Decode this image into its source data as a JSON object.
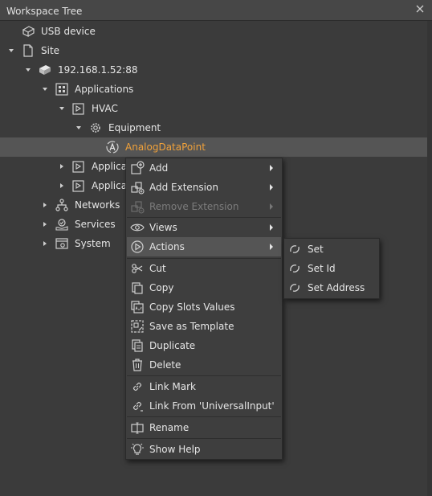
{
  "panel": {
    "title": "Workspace Tree"
  },
  "tree": {
    "usb_device": "USB device",
    "site": "Site",
    "ip": "192.168.1.52:88",
    "applications": "Applications",
    "hvac": "HVAC",
    "equipment": "Equipment",
    "analog_data_point": "AnalogDataPoint",
    "application_partial_1": "Applicat",
    "application_partial_2": "Applicat",
    "networks": "Networks",
    "services": "Services",
    "system": "System"
  },
  "context_menu": {
    "add": "Add",
    "add_extension": "Add Extension",
    "remove_extension": "Remove Extension",
    "views": "Views",
    "actions": "Actions",
    "cut": "Cut",
    "copy": "Copy",
    "copy_slots_values": "Copy Slots Values",
    "save_as_template": "Save as Template",
    "duplicate": "Duplicate",
    "delete": "Delete",
    "link_mark": "Link Mark",
    "link_from": "Link From 'UniversalInput'",
    "rename": "Rename",
    "show_help": "Show Help"
  },
  "actions_submenu": {
    "set": "Set",
    "set_id": "Set Id",
    "set_address": "Set Address"
  },
  "colors": {
    "background": "#3b3b3b",
    "header": "#474747",
    "selection": "#555555",
    "selected_text": "#f0a13a",
    "disabled_text": "#7c7c7c"
  }
}
